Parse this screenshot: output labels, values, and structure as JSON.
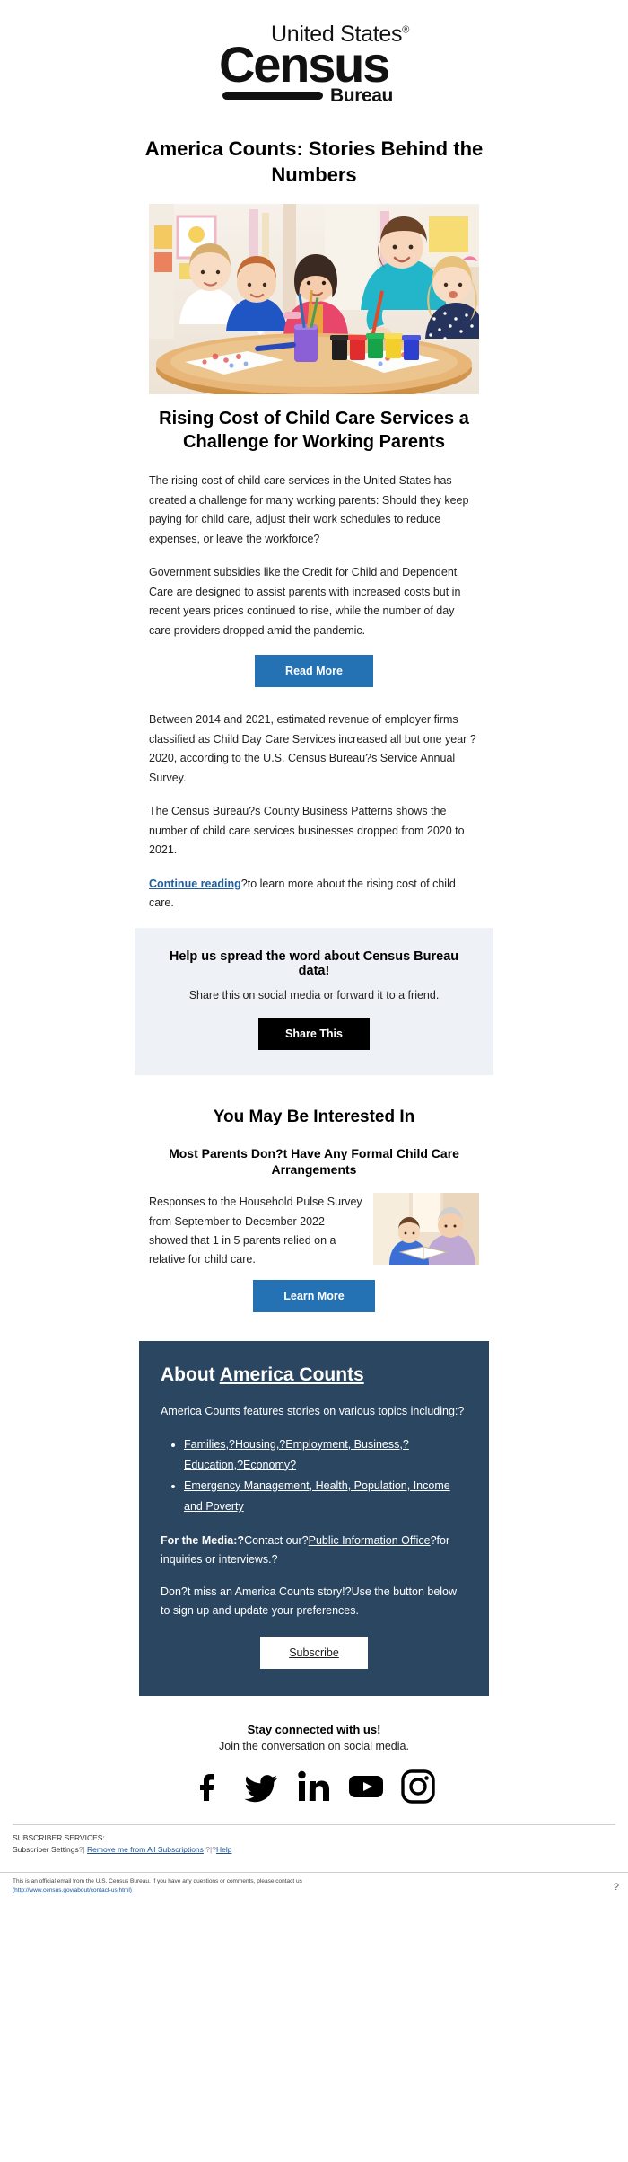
{
  "brand": {
    "logo_line1": "United States",
    "logo_reg": "®",
    "logo_line2": "Census",
    "logo_line3": "Bureau",
    "accent_blue": "#2472b4",
    "dark_navy": "#2a4660",
    "share_band_bg": "#eef1f5",
    "link_blue": "#1f5fa0",
    "black_button": "#000000"
  },
  "masthead": {
    "title": "America Counts: Stories Behind the Numbers"
  },
  "hero": {
    "alt": "Children painting at a table with a teacher at a child care center"
  },
  "article": {
    "heading": "Rising Cost of Child Care Services a Challenge for Working Parents",
    "paragraph_1": "The rising cost of child care services in the United States has created a challenge for many working parents: Should they keep paying for child care, adjust their work schedules to reduce expenses, or leave the workforce?",
    "paragraph_2": "Government subsidies like the Credit for Child and Dependent Care are designed to assist parents with increased costs but in recent years prices continued to rise, while the number of day care providers dropped amid the pandemic.",
    "read_more_label": "Read More",
    "paragraph_3": "Between 2014 and 2021, estimated revenue of employer firms classified as Child Day Care Services increased all but one year ? 2020, according to the U.S. Census Bureau?s Service Annual Survey.",
    "paragraph_4": "The Census Bureau?s County Business Patterns shows the number of child care services businesses dropped from 2020 to 2021.",
    "continue_link_label": "Continue reading",
    "continue_trailing_text": "?to learn more about the rising cost of child care."
  },
  "share": {
    "heading": "Help us spread the word about Census Bureau data!",
    "subtext": "Share this on social media or forward it to a friend.",
    "button_label": "Share This"
  },
  "interested": {
    "section_title": "You May Be Interested In",
    "item_title": "Most Parents Don?t Have Any Formal Child Care Arrangements",
    "item_text": "Responses to the Household Pulse Survey from September to December 2022 showed that 1 in 5 parents relied on a relative for child care.",
    "item_thumb_alt": "Grandmother reading a book with a child",
    "learn_more_label": "Learn More"
  },
  "about": {
    "heading_prefix": "About ",
    "heading_underlined": "America Counts",
    "intro": "America Counts features stories on various topics including:?",
    "topic_lines": [
      "Families,?Housing,?Employment, Business,?Education,?Economy?",
      "Emergency Management, Health, Population, Income and Poverty"
    ],
    "media_label": "For the Media:?",
    "media_text_before": "Contact our?",
    "media_link": "Public Information Office",
    "media_text_after": "?for inquiries or interviews.?",
    "signup_text": "Don?t miss an America Counts story!?Use the button below to sign up and update your preferences.",
    "subscribe_label": "Subscribe"
  },
  "connect": {
    "heading": "Stay connected with us!",
    "subtext": "Join the conversation on social media.",
    "icons": [
      "facebook-icon",
      "twitter-icon",
      "linkedin-icon",
      "youtube-icon",
      "instagram-icon"
    ]
  },
  "footer": {
    "subscriber_services_label": "SUBSCRIBER SERVICES:",
    "subscriber_settings": "Subscriber Settings",
    "sep1": "?| ",
    "remove_link": "Remove me from All Subscriptions",
    "sep2": " ?|?",
    "help_link": "Help",
    "official_text": "This is an official email from the U.S. Census Bureau. If you have any questions or comments, please contact us",
    "contact_url_text": "(http://www.census.gov/about/contact-us.html)",
    "help_marker": "?"
  }
}
